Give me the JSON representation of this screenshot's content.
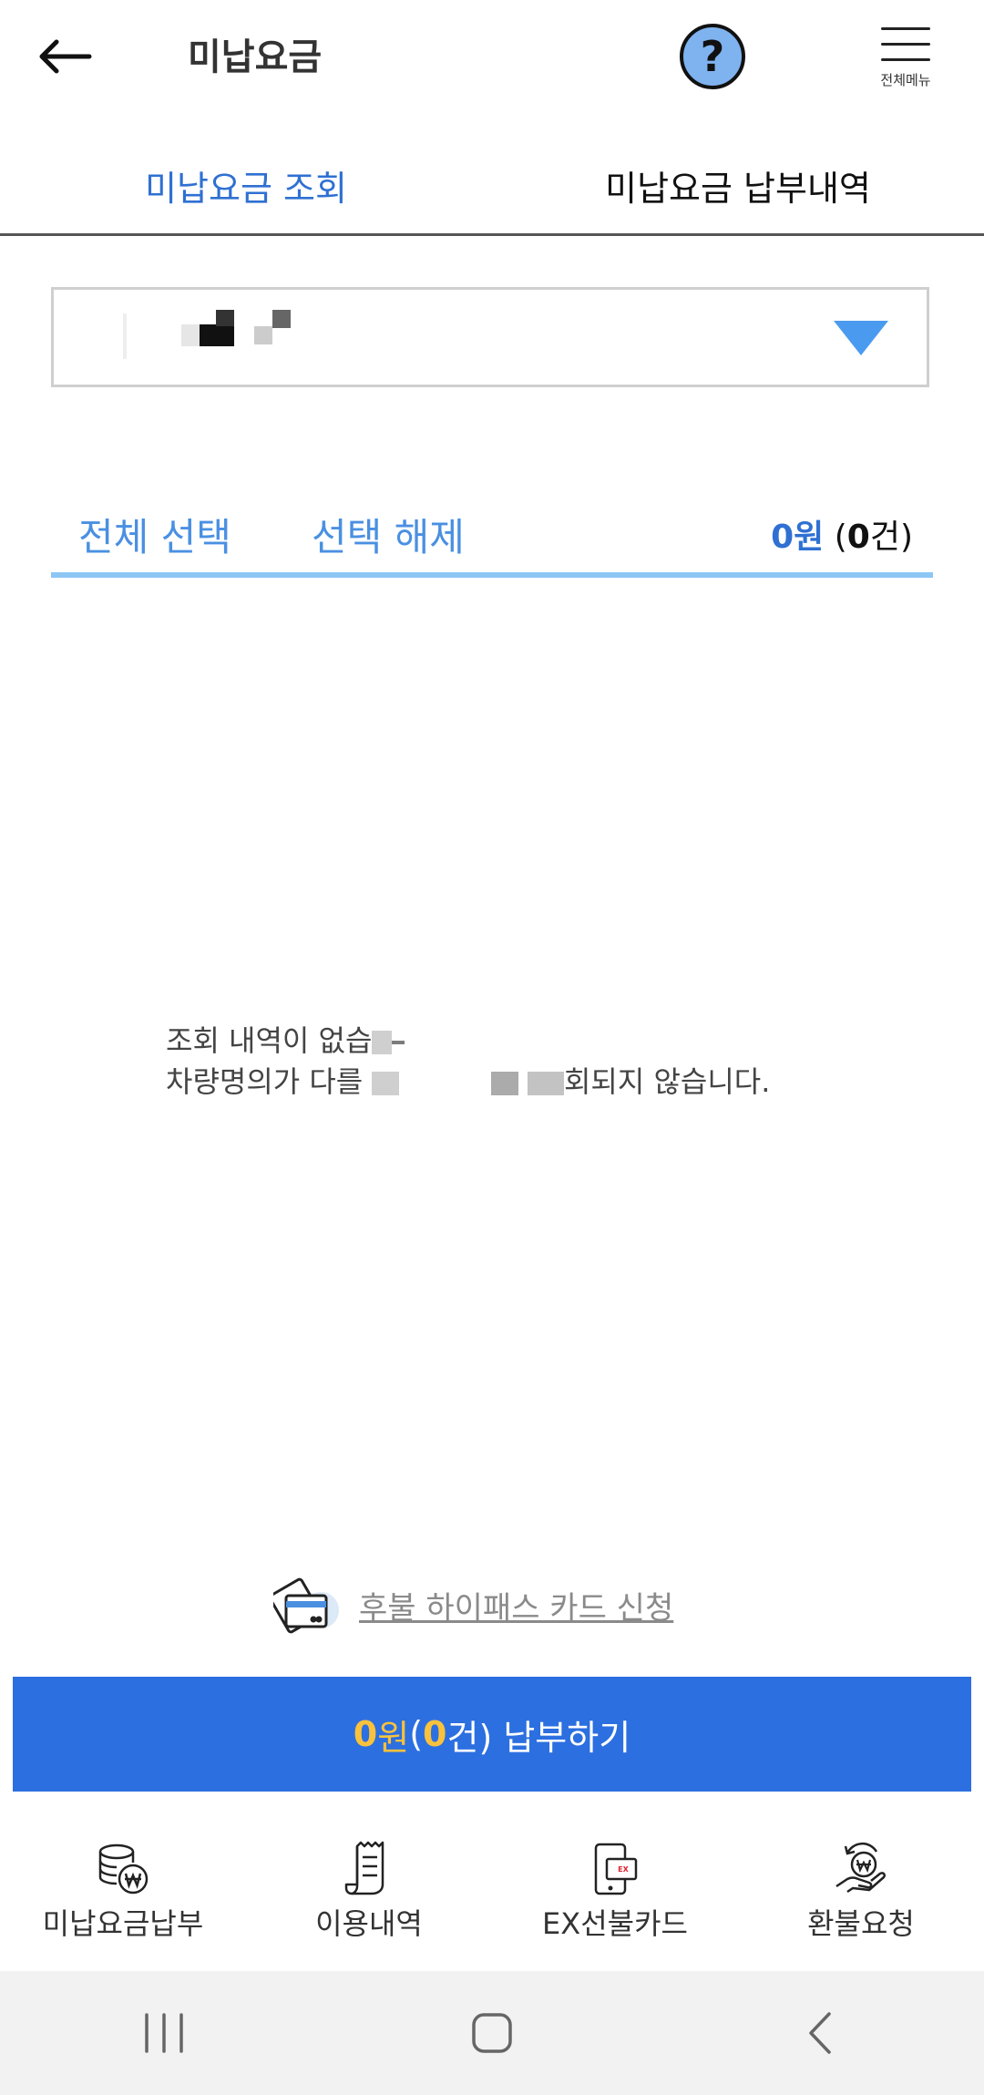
{
  "header": {
    "title": "미납요금",
    "menu_label": "전체메뉴"
  },
  "tabs": [
    {
      "label": "미납요금 조회",
      "active": true
    },
    {
      "label": "미납요금 납부내역",
      "active": false
    }
  ],
  "selection": {
    "select_all": "전체 선택",
    "deselect": "선택 해제",
    "amount": "0",
    "amount_unit": "원",
    "count_open": "(",
    "count": "0",
    "count_unit": "건)"
  },
  "empty": {
    "line1": "조회 내역이 없습",
    "line2_start": "차량명의가 다를",
    "line2_end": "회되지 않습니다."
  },
  "apply_link": "후불 하이패스 카드 신청",
  "pay_button": {
    "amount": "0",
    "amount_unit": "원",
    "open": " (",
    "count": "0",
    "suffix": "건) 납부하기"
  },
  "bottom_nav": [
    {
      "label": "미납요금납부",
      "icon": "coin-won-icon"
    },
    {
      "label": "이용내역",
      "icon": "receipt-icon"
    },
    {
      "label": "EX선불카드",
      "icon": "prepaid-card-icon"
    },
    {
      "label": "환불요청",
      "icon": "refund-hand-icon"
    }
  ],
  "colors": {
    "accent": "#2f70d2",
    "pay_button": "#2c6fe0",
    "highlight": "#f9c23c",
    "help_icon": "#7fb3ef"
  }
}
